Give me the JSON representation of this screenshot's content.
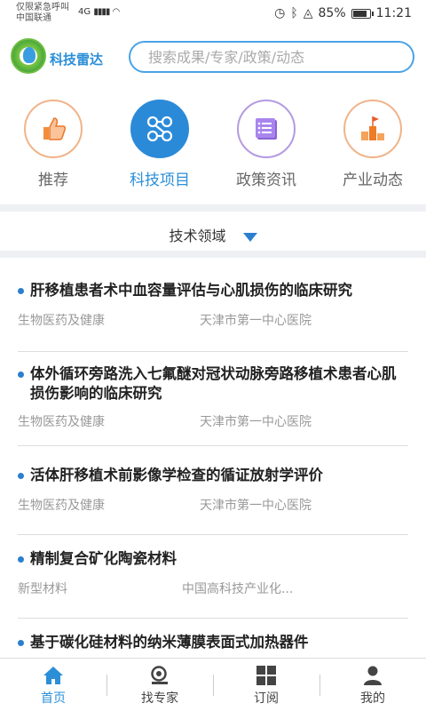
{
  "status_bar": {
    "line1": "仅限紧急呼叫",
    "line2": "中国联通",
    "network": "4G",
    "battery_percent": "85%",
    "battery_level": 0.85,
    "time": "11:21"
  },
  "header": {
    "app_name": "科技雷达",
    "search_placeholder": "搜索成果/专家/政策/动态"
  },
  "categories": [
    {
      "label": "推荐",
      "icon": "thumbs-up-icon",
      "active": false
    },
    {
      "label": "科技项目",
      "icon": "network-nodes-icon",
      "active": true
    },
    {
      "label": "政策资讯",
      "icon": "document-list-icon",
      "active": false
    },
    {
      "label": "产业动态",
      "icon": "flag-podium-icon",
      "active": false
    }
  ],
  "filter": {
    "label": "技术领域"
  },
  "list": [
    {
      "title": "肝移植患者术中血容量评估与心肌损伤的临床研究",
      "field": "生物医药及健康",
      "org": "天津市第一中心医院"
    },
    {
      "title": "体外循环旁路洗入七氟醚对冠状动脉旁路移植术患者心肌损伤影响的临床研究",
      "field": "生物医药及健康",
      "org": "天津市第一中心医院"
    },
    {
      "title": "活体肝移植术前影像学检查的循证放射学评价",
      "field": "生物医药及健康",
      "org": "天津市第一中心医院"
    },
    {
      "title": "精制复合矿化陶瓷材料",
      "field": "新型材料",
      "org": "中国高科技产业化..."
    },
    {
      "title": "基于碳化硅材料的纳米薄膜表面式加热器件",
      "field": "",
      "org": ""
    }
  ],
  "bottom_nav": [
    {
      "label": "首页",
      "icon": "home-icon",
      "active": true
    },
    {
      "label": "找专家",
      "icon": "expert-search-icon",
      "active": false
    },
    {
      "label": "订阅",
      "icon": "grid-icon",
      "active": false
    },
    {
      "label": "我的",
      "icon": "user-icon",
      "active": false
    }
  ],
  "colors": {
    "accent": "#2b8fd8",
    "bullet": "#2b7fcf",
    "meta_text": "#999999"
  }
}
